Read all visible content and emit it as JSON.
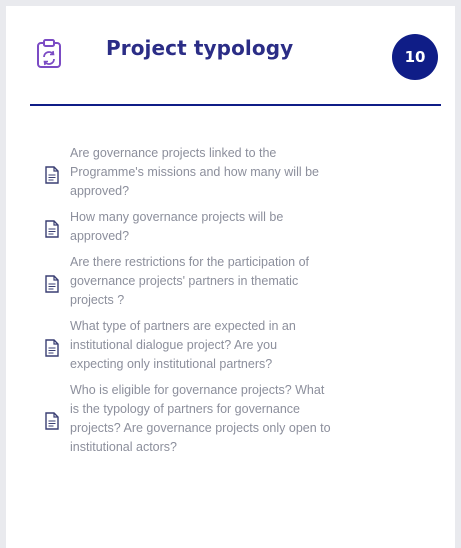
{
  "card": {
    "title": "Project typology",
    "count": "10",
    "icon": "clipboard-refresh-icon",
    "colors": {
      "title": "#2b2d86",
      "badge": "#0f1d87",
      "divider": "#0f1d87",
      "icon": "#7b4bc4",
      "text": "#8c8f9c"
    }
  },
  "faq_items": [
    {
      "icon": "document-icon",
      "lines": [
        "Are governance projects linked to the",
        "Programme's missions and how many will be",
        "approved?"
      ]
    },
    {
      "icon": "document-icon",
      "lines": [
        "How many governance projects will be",
        "approved?"
      ]
    },
    {
      "icon": "document-icon",
      "lines": [
        "Are there restrictions for the participation of",
        "governance projects' partners in thematic",
        "projects ?"
      ]
    },
    {
      "icon": "document-icon",
      "lines": [
        "What type of partners are expected in an",
        "institutional dialogue project? Are you",
        "expecting only institutional partners?"
      ]
    },
    {
      "icon": "document-icon",
      "lines": [
        "Who is eligible for governance projects? What",
        "is the typology of partners for governance",
        "projects? Are governance projects only open to",
        "institutional actors?"
      ]
    }
  ]
}
